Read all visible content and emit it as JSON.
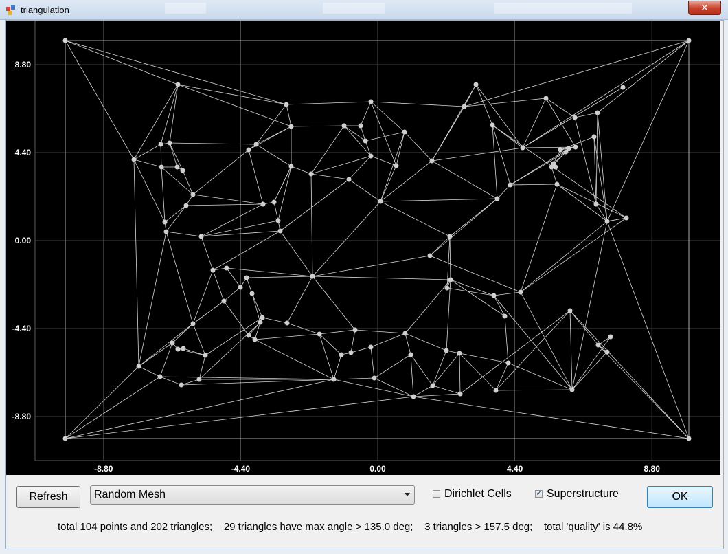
{
  "window": {
    "title": "triangulation",
    "close_label": "✕"
  },
  "plot": {
    "x_ticks": [
      "-8.80",
      "-4.40",
      "0.00",
      "4.40",
      "8.80"
    ],
    "y_ticks": [
      "8.80",
      "4.40",
      "0.00",
      "-4.40",
      "-8.80"
    ],
    "x_tick_values": [
      -8.8,
      -4.4,
      0,
      4.4,
      8.8
    ],
    "y_tick_values": [
      8.8,
      4.4,
      0,
      -4.4,
      -8.8
    ],
    "xlim": [
      -11,
      11
    ],
    "ylim": [
      -11,
      11
    ],
    "grid": true,
    "background_color": "#000000",
    "line_color": "#d8d8d8",
    "grid_color": "#5a5a5a"
  },
  "controls": {
    "refresh_label": "Refresh",
    "mesh_select_value": "Random Mesh",
    "dirichlet_label": "Dirichlet Cells",
    "dirichlet_checked": false,
    "superstructure_label": "Superstructure",
    "superstructure_checked": true,
    "ok_label": "OK"
  },
  "status": {
    "text": "total 104 points and 202 triangles;    29 triangles have max angle > 135.0 deg;    3 triangles > 157.5 deg;    total 'quality' is 44.8%"
  }
}
